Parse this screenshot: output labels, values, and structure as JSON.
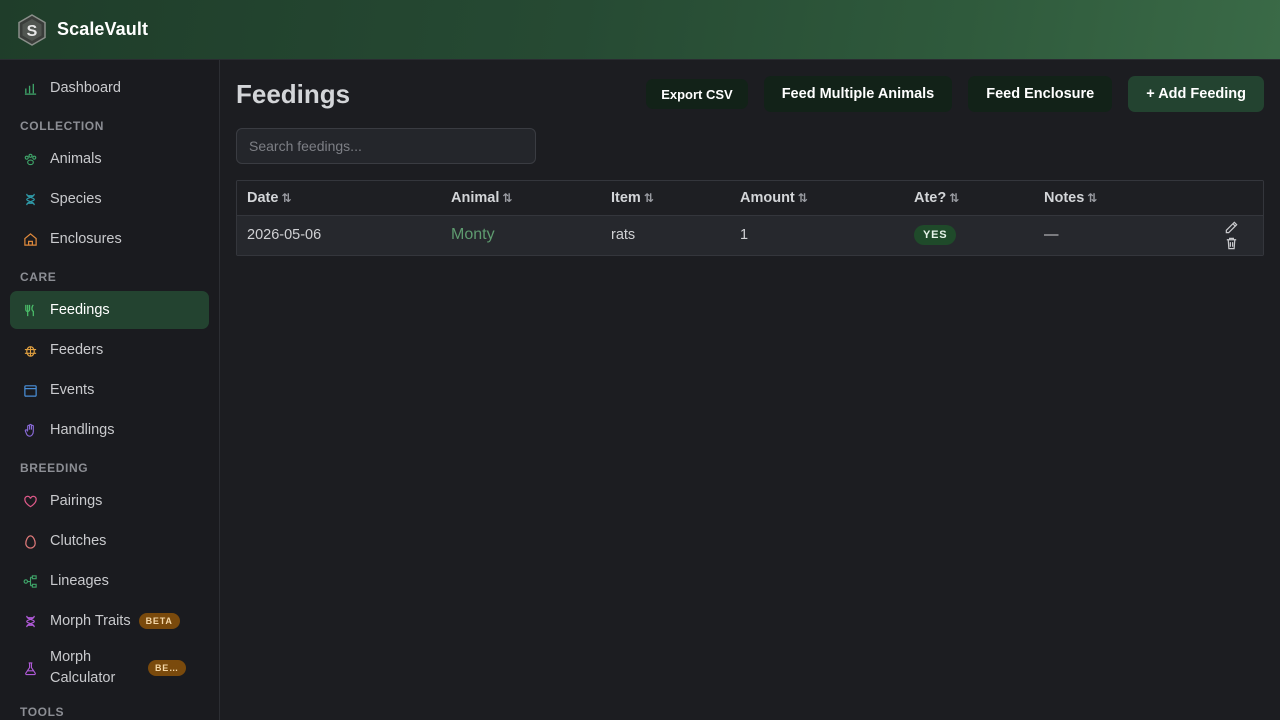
{
  "app": {
    "title": "ScaleVault"
  },
  "sidebar": {
    "top_items": [
      {
        "label": "Dashboard",
        "icon": "bar-chart-icon"
      }
    ],
    "sections": [
      {
        "title": "COLLECTION",
        "items": [
          {
            "label": "Animals",
            "icon": "paw-icon",
            "color": "#3fa66a"
          },
          {
            "label": "Species",
            "icon": "dna-icon",
            "color": "#2f9aa8"
          },
          {
            "label": "Enclosures",
            "icon": "home-icon",
            "color": "#e08a3c"
          }
        ]
      },
      {
        "title": "CARE",
        "items": [
          {
            "label": "Feedings",
            "icon": "utensils-icon",
            "color": "#4cc06b",
            "active": true
          },
          {
            "label": "Feeders",
            "icon": "bug-icon",
            "color": "#e0a040"
          },
          {
            "label": "Events",
            "icon": "calendar-icon",
            "color": "#4a8fd8"
          },
          {
            "label": "Handlings",
            "icon": "hand-icon",
            "color": "#8a6ad8"
          }
        ]
      },
      {
        "title": "BREEDING",
        "items": [
          {
            "label": "Pairings",
            "icon": "heart-icon",
            "color": "#e05a8a"
          },
          {
            "label": "Clutches",
            "icon": "egg-icon",
            "color": "#e07a7a"
          },
          {
            "label": "Lineages",
            "icon": "tree-icon",
            "color": "#3fa66a"
          },
          {
            "label": "Morph Traits",
            "icon": "dna-icon",
            "color": "#b05ad8",
            "badge": "BETA"
          },
          {
            "label": "Morph Calculator",
            "icon": "flask-icon",
            "color": "#b05ad8",
            "badge": "BETA"
          }
        ]
      },
      {
        "title": "TOOLS",
        "items": []
      }
    ]
  },
  "page": {
    "title": "Feedings",
    "actions": {
      "export_csv": "Export CSV",
      "feed_multiple": "Feed Multiple Animals",
      "feed_enclosure": "Feed Enclosure",
      "add_feeding": "+ Add Feeding"
    },
    "search": {
      "placeholder": "Search feedings..."
    },
    "table": {
      "columns": [
        "Date",
        "Animal",
        "Item",
        "Amount",
        "Ate?",
        "Notes"
      ],
      "rows": [
        {
          "date": "2026-05-06",
          "animal": "Monty",
          "item": "rats",
          "amount": "1",
          "ate": "YES",
          "notes": "—"
        }
      ]
    }
  }
}
